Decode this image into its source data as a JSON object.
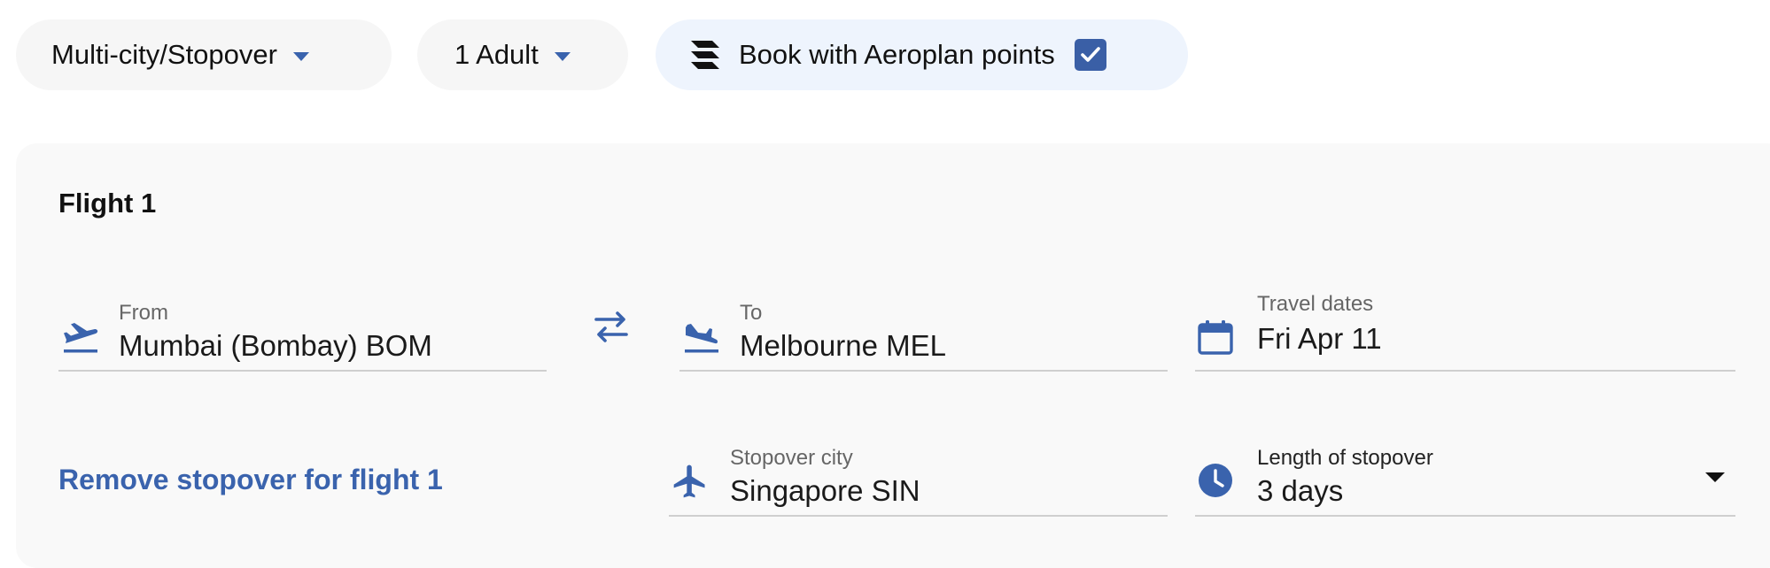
{
  "topbar": {
    "trip_type": "Multi-city/Stopover",
    "passengers": "1 Adult",
    "aeroplan_label": "Book with Aeroplan points",
    "aeroplan_checked": true
  },
  "flight": {
    "title": "Flight 1",
    "from": {
      "label": "From",
      "value": "Mumbai (Bombay) BOM",
      "icon": "plane-takeoff-icon"
    },
    "to": {
      "label": "To",
      "value": "Melbourne MEL",
      "icon": "plane-landing-icon"
    },
    "dates": {
      "label": "Travel dates",
      "value": "Fri Apr 11",
      "icon": "calendar-icon"
    },
    "stopover_city": {
      "label": "Stopover city",
      "value": "Singapore SIN",
      "icon": "plane-icon"
    },
    "stopover_length": {
      "label": "Length of stopover",
      "value": "3 days",
      "icon": "clock-icon"
    },
    "remove_stopover": "Remove stopover for flight 1"
  },
  "colors": {
    "accent": "#3a63ad",
    "checkbox": "#3a5fa6",
    "panel_bg": "#f9f9f9",
    "pill_bg": "#f6f6f6",
    "aeroplan_bg": "#eef4fd"
  }
}
